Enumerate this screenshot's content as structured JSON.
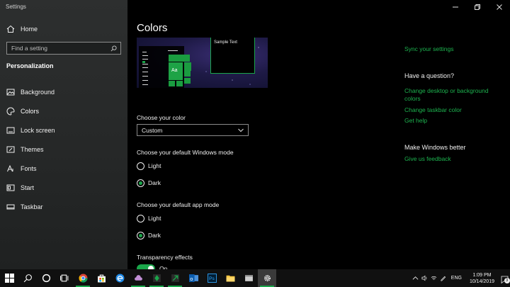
{
  "window": {
    "title": "Settings"
  },
  "sidebar": {
    "home_label": "Home",
    "search_placeholder": "Find a setting",
    "section_title": "Personalization",
    "items": [
      {
        "label": "Background",
        "icon": "image-icon"
      },
      {
        "label": "Colors",
        "icon": "palette-icon"
      },
      {
        "label": "Lock screen",
        "icon": "lock-screen-icon"
      },
      {
        "label": "Themes",
        "icon": "brush-icon"
      },
      {
        "label": "Fonts",
        "icon": "font-icon"
      },
      {
        "label": "Start",
        "icon": "start-icon"
      },
      {
        "label": "Taskbar",
        "icon": "taskbar-icon"
      }
    ],
    "active_item": "Colors"
  },
  "main": {
    "title": "Colors",
    "preview": {
      "tile_text": "Aa",
      "window_text": "Sample Text"
    },
    "choose_color": {
      "label": "Choose your color",
      "selected": "Custom"
    },
    "windows_mode": {
      "label": "Choose your default Windows mode",
      "options": [
        "Light",
        "Dark"
      ],
      "selected": "Dark"
    },
    "app_mode": {
      "label": "Choose your default app mode",
      "options": [
        "Light",
        "Dark"
      ],
      "selected": "Dark"
    },
    "transparency": {
      "label": "Transparency effects",
      "state": "On",
      "on": true
    }
  },
  "right_panel": {
    "sync_link": "Sync your settings",
    "question_heading": "Have a question?",
    "help_links": [
      "Change desktop or background colors",
      "Change taskbar color",
      "Get help"
    ],
    "feedback_heading": "Make Windows better",
    "feedback_link": "Give us feedback"
  },
  "taskbar": {
    "time": "1:09 PM",
    "date": "10/14/2019",
    "language": "ENG",
    "notification_count": "3"
  },
  "colors": {
    "accent": "#1aa64a",
    "link": "#1db34f",
    "sidebar_bg": "#2b2d2d",
    "taskbar_bg": "#101010"
  }
}
